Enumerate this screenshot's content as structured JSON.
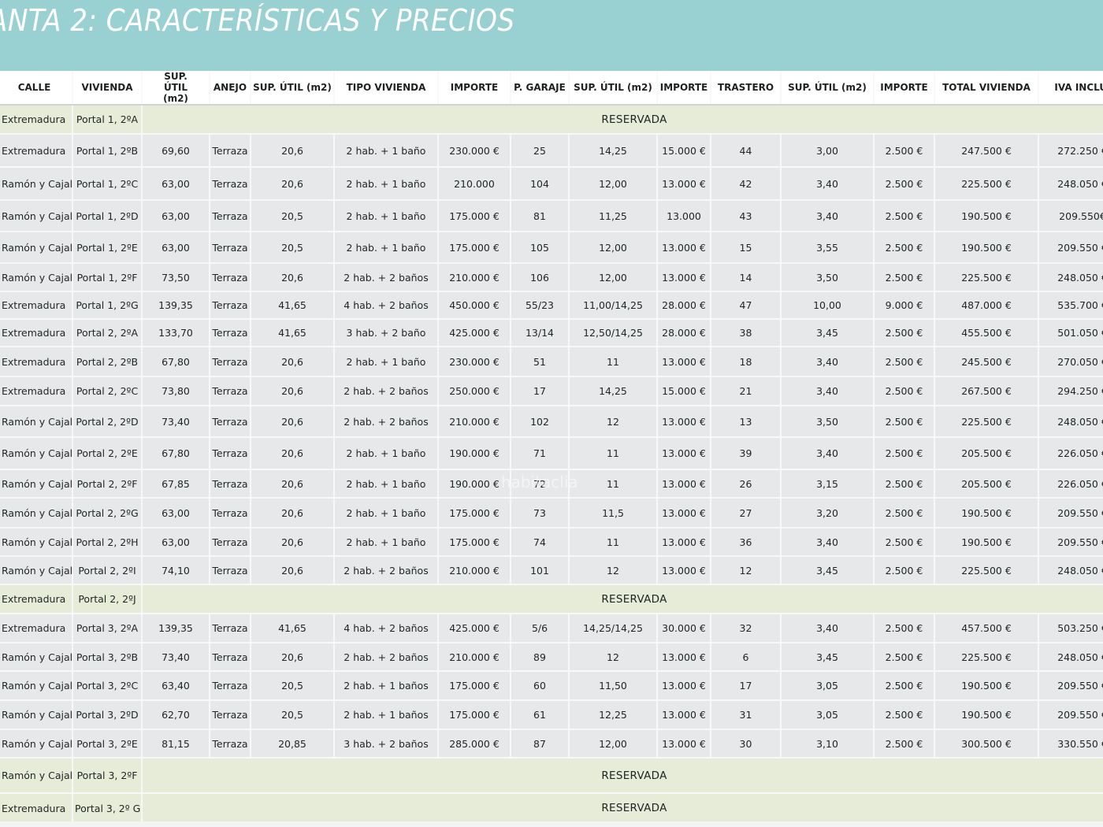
{
  "banner": {
    "title": "ANTA 2: CARACTERÍSTICAS Y PRECIOS"
  },
  "watermark": "habitaclia",
  "columns": [
    "CALLE",
    "VIVIENDA",
    "SUP. ÚTIL (m2)",
    "ANEJO",
    "SUP. ÚTIL (m2)",
    "TIPO VIVIENDA",
    "IMPORTE",
    "P. GARAJE",
    "SUP. ÚTIL (m2)",
    "IMPORTE",
    "TRASTERO",
    "SUP. ÚTIL (m2)",
    "IMPORTE",
    "TOTAL VIVIENDA",
    "IVA INCLUI"
  ],
  "reserved_label": "RESERVADA",
  "rows": [
    {
      "reserved": true,
      "calle": "Extremadura",
      "vivienda": "Portal 1, 2ºA"
    },
    {
      "cells": [
        "Extremadura",
        "Portal 1, 2ºB",
        "69,60",
        "Terraza",
        "20,6",
        "2 hab. + 1 baño",
        "230.000 €",
        "25",
        "14,25",
        "15.000 €",
        "44",
        "3,00",
        "2.500 €",
        "247.500 €",
        "272.250 €"
      ]
    },
    {
      "cells": [
        "Ramón y Cajal",
        "Portal 1, 2ºC",
        "63,00",
        "Terraza",
        "20,6",
        "2 hab. + 1 baño",
        "210.000",
        "104",
        "12,00",
        "13.000 €",
        "42",
        "3,40",
        "2.500 €",
        "225.500 €",
        "248.050 €"
      ]
    },
    {
      "cells": [
        "Ramón y Cajal",
        "Portal 1, 2ºD",
        "63,00",
        "Terraza",
        "20,5",
        "2 hab. + 1 baño",
        "175.000 €",
        "81",
        "11,25",
        "13.000",
        "43",
        "3,40",
        "2.500 €",
        "190.500 €",
        "209.550€"
      ]
    },
    {
      "cells": [
        "Ramón y Cajal",
        "Portal 1, 2ºE",
        "63,00",
        "Terraza",
        "20,5",
        "2 hab. + 1 baño",
        "175.000 €",
        "105",
        "12,00",
        "13.000 €",
        "15",
        "3,55",
        "2.500 €",
        "190.500 €",
        "209.550 €"
      ]
    },
    {
      "cells": [
        "Ramón y Cajal",
        "Portal 1, 2ºF",
        "73,50",
        "Terraza",
        "20,6",
        "2 hab. + 2 baños",
        "210.000 €",
        "106",
        "12,00",
        "13.000 €",
        "14",
        "3,50",
        "2.500 €",
        "225.500 €",
        "248.050 €"
      ]
    },
    {
      "cells": [
        "Extremadura",
        "Portal 1, 2ºG",
        "139,35",
        "Terraza",
        "41,65",
        "4 hab. + 2 baños",
        "450.000 €",
        "55/23",
        "11,00/14,25",
        "28.000 €",
        "47",
        "10,00",
        "9.000 €",
        "487.000 €",
        "535.700 €"
      ]
    },
    {
      "cells": [
        "Extremadura",
        "Portal 2, 2ºA",
        "133,70",
        "Terraza",
        "41,65",
        "3 hab. + 2 baño",
        "425.000 €",
        "13/14",
        "12,50/14,25",
        "28.000 €",
        "38",
        "3,45",
        "2.500 €",
        "455.500 €",
        "501.050 €"
      ]
    },
    {
      "cells": [
        "Extremadura",
        "Portal 2, 2ºB",
        "67,80",
        "Terraza",
        "20,6",
        "2 hab. + 1 baño",
        "230.000 €",
        "51",
        "11",
        "13.000 €",
        "18",
        "3,40",
        "2.500 €",
        "245.500 €",
        "270.050 €"
      ]
    },
    {
      "cells": [
        "Extremadura",
        "Portal 2, 2ºC",
        "73,80",
        "Terraza",
        "20,6",
        "2 hab. + 2 baños",
        "250.000 €",
        "17",
        "14,25",
        "15.000 €",
        "21",
        "3,40",
        "2.500 €",
        "267.500 €",
        "294.250 €"
      ]
    },
    {
      "cells": [
        "Ramón y Cajal",
        "Portal 2, 2ºD",
        "73,40",
        "Terraza",
        "20,6",
        "2 hab. + 2 baños",
        "210.000 €",
        "102",
        "12",
        "13.000 €",
        "13",
        "3,50",
        "2.500 €",
        "225.500 €",
        "248.050 €"
      ]
    },
    {
      "cells": [
        "Ramón y Cajal",
        "Portal 2, 2ºE",
        "67,80",
        "Terraza",
        "20,6",
        "2 hab. + 1 baño",
        "190.000 €",
        "71",
        "11",
        "13.000 €",
        "39",
        "3,40",
        "2.500 €",
        "205.500 €",
        "226.050 €"
      ]
    },
    {
      "cells": [
        "Ramón y Cajal",
        "Portal 2, 2ºF",
        "67,85",
        "Terraza",
        "20,6",
        "2 hab. + 1 baño",
        "190.000 €",
        "72",
        "11",
        "13.000 €",
        "26",
        "3,15",
        "2.500 €",
        "205.500 €",
        "226.050 €"
      ]
    },
    {
      "cells": [
        "Ramón y Cajal",
        "Portal 2, 2ºG",
        "63,00",
        "Terraza",
        "20,6",
        "2 hab. + 1 baño",
        "175.000 €",
        "73",
        "11,5",
        "13.000 €",
        "27",
        "3,20",
        "2.500 €",
        "190.500 €",
        "209.550 €"
      ]
    },
    {
      "cells": [
        "Ramón y Cajal",
        "Portal 2, 2ºH",
        "63,00",
        "Terraza",
        "20,6",
        "2 hab. + 1 baño",
        "175.000 €",
        "74",
        "11",
        "13.000 €",
        "36",
        "3,40",
        "2.500 €",
        "190.500 €",
        "209.550 €"
      ]
    },
    {
      "cells": [
        "Ramón y Cajal",
        "Portal 2, 2ºI",
        "74,10",
        "Terraza",
        "20,6",
        "2 hab. + 2 baños",
        "210.000 €",
        "101",
        "12",
        "13.000 €",
        "12",
        "3,45",
        "2.500 €",
        "225.500 €",
        "248.050 €"
      ]
    },
    {
      "reserved": true,
      "calle": "Extremadura",
      "vivienda": "Portal 2, 2ºJ"
    },
    {
      "cells": [
        "Extremadura",
        "Portal 3, 2ºA",
        "139,35",
        "Terraza",
        "41,65",
        "4 hab. + 2 baños",
        "425.000 €",
        "5/6",
        "14,25/14,25",
        "30.000 €",
        "32",
        "3,40",
        "2.500 €",
        "457.500 €",
        "503.250 €"
      ]
    },
    {
      "cells": [
        "Ramón y Cajal",
        "Portal 3, 2ºB",
        "73,40",
        "Terraza",
        "20,6",
        "2 hab. + 2 baños",
        "210.000 €",
        "89",
        "12",
        "13.000 €",
        "6",
        "3,45",
        "2.500 €",
        "225.500 €",
        "248.050 €"
      ]
    },
    {
      "cells": [
        "Ramón y Cajal",
        "Portal 3, 2ºC",
        "63,40",
        "Terraza",
        "20,5",
        "2 hab. + 1 baños",
        "175.000 €",
        "60",
        "11,50",
        "13.000 €",
        "17",
        "3,05",
        "2.500 €",
        "190.500 €",
        "209.550 €"
      ]
    },
    {
      "cells": [
        "Ramón y Cajal",
        "Portal 3, 2ºD",
        "62,70",
        "Terraza",
        "20,5",
        "2 hab. + 1 baños",
        "175.000 €",
        "61",
        "12,25",
        "13.000 €",
        "31",
        "3,05",
        "2.500 €",
        "190.500 €",
        "209.550 €"
      ]
    },
    {
      "cells": [
        "Ramón y Cajal",
        "Portal 3, 2ºE",
        "81,15",
        "Terraza",
        "20,85",
        "3 hab. + 2 baños",
        "285.000 €",
        "87",
        "12,00",
        "13.000 €",
        "30",
        "3,10",
        "2.500 €",
        "300.500 €",
        "330.550 €"
      ]
    },
    {
      "reserved": true,
      "calle": "Ramón y Cajal",
      "vivienda": "Portal 3, 2ºF"
    },
    {
      "reserved": true,
      "calle": "Extremadura",
      "vivienda": "Portal 3, 2º G"
    }
  ]
}
